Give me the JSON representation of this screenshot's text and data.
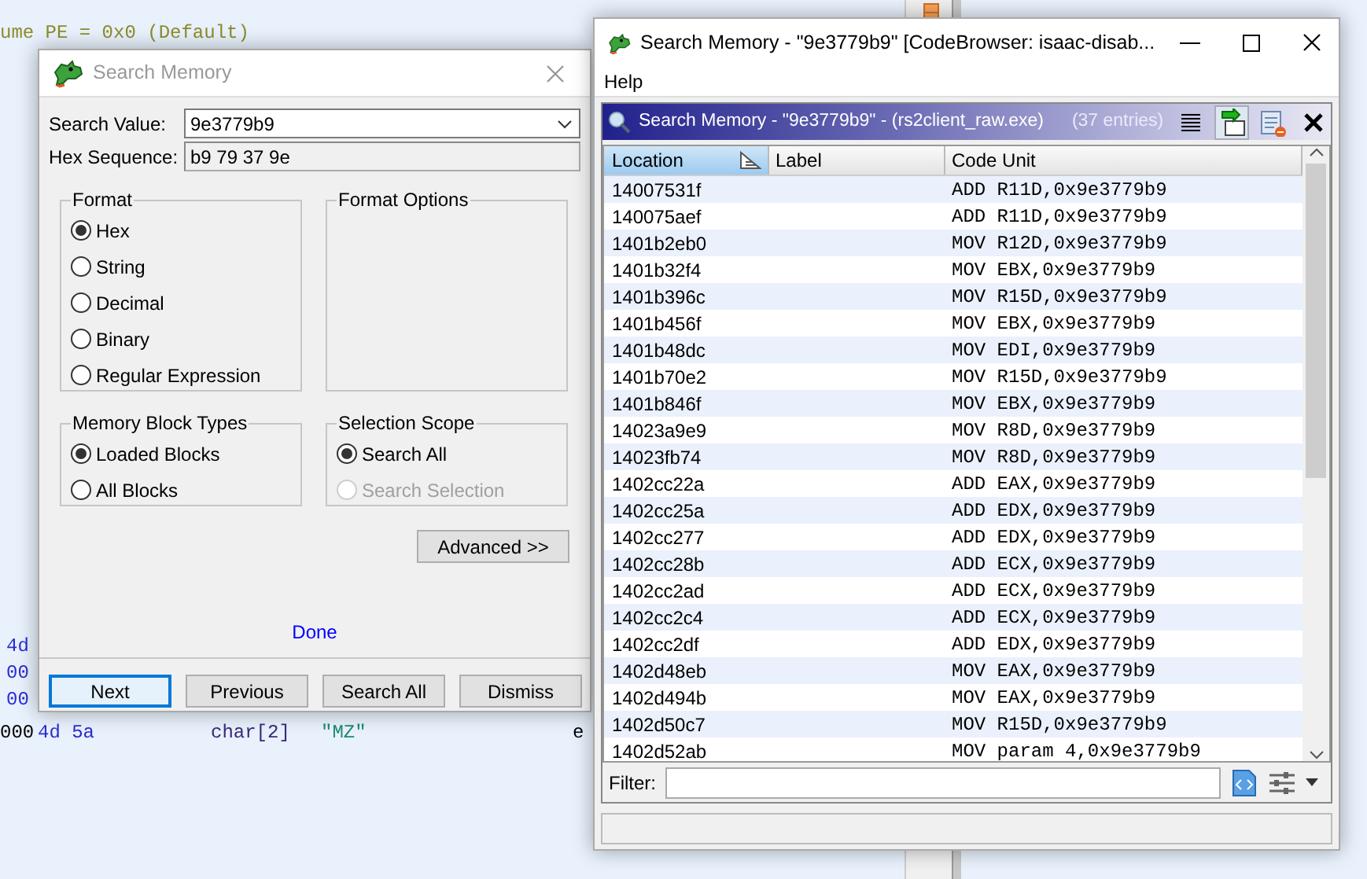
{
  "background_listing": {
    "header_line": "ume PE = 0x0  (Default)",
    "byte_lines": [
      "4d",
      "00",
      "00"
    ],
    "data_line": {
      "address": "000",
      "bytes": "4d 5a",
      "type": "char[2]",
      "value": "\"MZ\"",
      "column_5": "e"
    }
  },
  "search_dialog": {
    "title": "Search Memory",
    "search_value": {
      "label": "Search Value:",
      "value": "9e3779b9"
    },
    "hex_sequence": {
      "label": "Hex Sequence:",
      "value": "b9 79 37 9e"
    },
    "format": {
      "title": "Format",
      "options": [
        {
          "label": "Hex",
          "selected": true,
          "disabled": false
        },
        {
          "label": "String",
          "selected": false,
          "disabled": false
        },
        {
          "label": "Decimal",
          "selected": false,
          "disabled": false
        },
        {
          "label": "Binary",
          "selected": false,
          "disabled": false
        },
        {
          "label": "Regular Expression",
          "selected": false,
          "disabled": false
        }
      ]
    },
    "format_options": {
      "title": "Format Options"
    },
    "memory_block_types": {
      "title": "Memory Block Types",
      "options": [
        {
          "label": "Loaded Blocks",
          "selected": true,
          "disabled": false
        },
        {
          "label": "All Blocks",
          "selected": false,
          "disabled": false
        }
      ]
    },
    "selection_scope": {
      "title": "Selection Scope",
      "options": [
        {
          "label": "Search All",
          "selected": true,
          "disabled": false
        },
        {
          "label": "Search Selection",
          "selected": false,
          "disabled": true
        }
      ]
    },
    "advanced_button": "Advanced >>",
    "status": "Done",
    "buttons": [
      {
        "label": "Next",
        "default": true
      },
      {
        "label": "Previous",
        "default": false
      },
      {
        "label": "Search All",
        "default": false
      },
      {
        "label": "Dismiss",
        "default": false
      }
    ]
  },
  "results_window": {
    "title": "Search Memory - \"9e3779b9\" [CodeBrowser: isaac-disab...",
    "menu": [
      "Help"
    ],
    "panel": {
      "title": "Search Memory - \"9e3779b9\" - (rs2client_raw.exe)",
      "count": "(37 entries)",
      "toolbar": [
        {
          "kind": "lines",
          "selected": false
        },
        {
          "kind": "navigate",
          "selected": true
        },
        {
          "kind": "table_delete",
          "selected": false
        },
        {
          "kind": "close",
          "selected": false
        }
      ]
    },
    "columns": [
      {
        "label": "Location",
        "sorted": true
      },
      {
        "label": "Label",
        "sorted": false
      },
      {
        "label": "Code Unit",
        "sorted": false
      }
    ],
    "rows": [
      {
        "location": "14007531f",
        "code_unit": "ADD R11D,0x9e3779b9"
      },
      {
        "location": "140075aef",
        "code_unit": "ADD R11D,0x9e3779b9"
      },
      {
        "location": "1401b2eb0",
        "code_unit": "MOV R12D,0x9e3779b9"
      },
      {
        "location": "1401b32f4",
        "code_unit": "MOV EBX,0x9e3779b9"
      },
      {
        "location": "1401b396c",
        "code_unit": "MOV R15D,0x9e3779b9"
      },
      {
        "location": "1401b456f",
        "code_unit": "MOV EBX,0x9e3779b9"
      },
      {
        "location": "1401b48dc",
        "code_unit": "MOV EDI,0x9e3779b9"
      },
      {
        "location": "1401b70e2",
        "code_unit": "MOV R15D,0x9e3779b9"
      },
      {
        "location": "1401b846f",
        "code_unit": "MOV EBX,0x9e3779b9"
      },
      {
        "location": "14023a9e9",
        "code_unit": "MOV R8D,0x9e3779b9"
      },
      {
        "location": "14023fb74",
        "code_unit": "MOV R8D,0x9e3779b9"
      },
      {
        "location": "1402cc22a",
        "code_unit": "ADD EAX,0x9e3779b9"
      },
      {
        "location": "1402cc25a",
        "code_unit": "ADD EDX,0x9e3779b9"
      },
      {
        "location": "1402cc277",
        "code_unit": "ADD EDX,0x9e3779b9"
      },
      {
        "location": "1402cc28b",
        "code_unit": "ADD ECX,0x9e3779b9"
      },
      {
        "location": "1402cc2ad",
        "code_unit": "ADD ECX,0x9e3779b9"
      },
      {
        "location": "1402cc2c4",
        "code_unit": "ADD ECX,0x9e3779b9"
      },
      {
        "location": "1402cc2df",
        "code_unit": "ADD EDX,0x9e3779b9"
      },
      {
        "location": "1402d48eb",
        "code_unit": "MOV EAX,0x9e3779b9"
      },
      {
        "location": "1402d494b",
        "code_unit": "MOV EAX,0x9e3779b9"
      },
      {
        "location": "1402d50c7",
        "code_unit": "MOV R15D,0x9e3779b9"
      },
      {
        "location": "1402d52ab",
        "code_unit": "MOV param 4,0x9e3779b9"
      }
    ],
    "filter": {
      "label": "Filter:"
    }
  }
}
